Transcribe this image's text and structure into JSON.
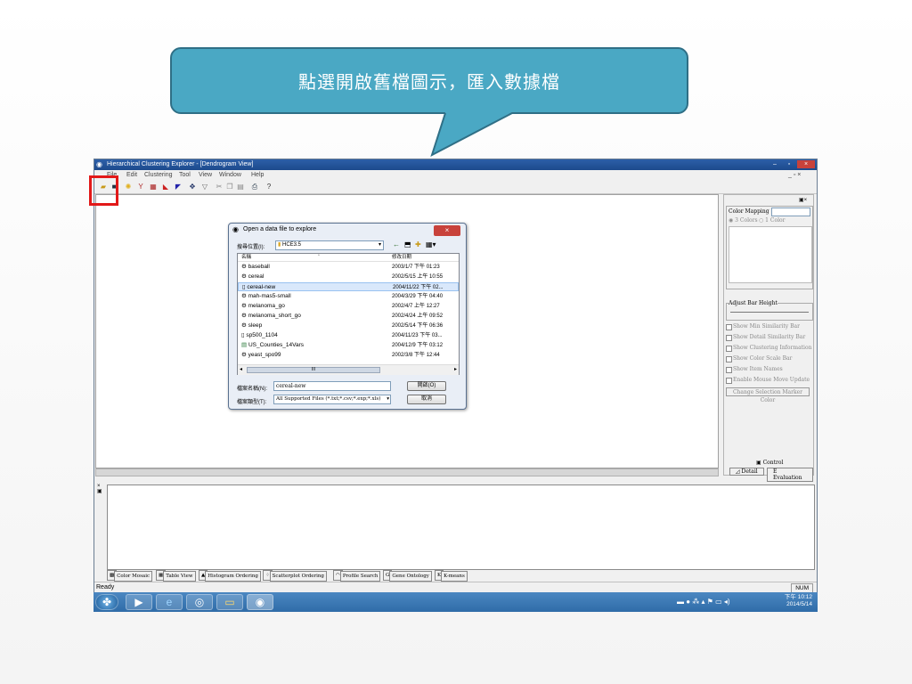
{
  "callout": {
    "text": "點選開啟舊檔圖示，匯入數據檔"
  },
  "window": {
    "title": "Hierarchical Clustering Explorer - [Dendrogram View]",
    "menu": [
      "File",
      "Edit",
      "Clustering",
      "Tool",
      "View",
      "Window",
      "Help"
    ]
  },
  "dialog": {
    "title": "Open a data file to explore",
    "look_in_label": "搜尋位置(I):",
    "look_in_value": "HCE3.5",
    "col_name": "名稱",
    "col_date": "修改日期",
    "files": [
      {
        "name": "baseball",
        "date": "2003/1/7 下午 01:23"
      },
      {
        "name": "cereal",
        "date": "2002/5/15 上午 10:55"
      },
      {
        "name": "cereal-new",
        "date": "2004/11/22 下午 02..."
      },
      {
        "name": "mah-mas5-small",
        "date": "2004/3/29 下午 04:40"
      },
      {
        "name": "melanoma_go",
        "date": "2002/4/7 上午 12:27"
      },
      {
        "name": "melanoma_short_go",
        "date": "2002/4/24 上午 09:52"
      },
      {
        "name": "sleep",
        "date": "2002/5/14 下午 06:36"
      },
      {
        "name": "sp500_1104",
        "date": "2004/11/23 下午 03..."
      },
      {
        "name": "US_Counties_14Vars",
        "date": "2004/12/9 下午 03:12"
      },
      {
        "name": "yeast_spo99",
        "date": "2002/3/8 下午 12:44"
      }
    ],
    "filename_label": "檔案名稱(N):",
    "filename_value": "cereal-new",
    "filetype_label": "檔案類型(T):",
    "filetype_value": "All Supported Files (*.txt;*.csv;*.exp;*.xls)",
    "open_button": "開啟(O)",
    "cancel_button": "取消",
    "scroll_mid": "III"
  },
  "control_panel": {
    "color_mapping": "Color Mapping",
    "three_colors": "3 Colors",
    "one_color": "1 Color",
    "adjust_bar": "Adjust Bar Height",
    "options": [
      "Show Min Similarity Bar",
      "Show Detail Similarity Bar",
      "Show Clustering Information",
      "Show Color Scale Bar",
      "Show Item Names",
      "Enable Mouse Move Update"
    ],
    "change_color_button": "Change Selection Marker Color",
    "control_tab": "Control",
    "detail_tab": "Detail",
    "evaluation_tab": "Evaluation"
  },
  "bottom_tabs": [
    "Color Mosaic",
    "Table View",
    "Histogram Ordering",
    "Scatterplot Ordering",
    "Profile Search",
    "Gene Ontology",
    "K-means"
  ],
  "status": {
    "ready": "Ready",
    "num": "NUM"
  },
  "taskbar": {
    "time": "下午 10:12",
    "date": "2014/5/14"
  },
  "colors": {
    "callout": "#4aa8c4",
    "highlight": "#e21818",
    "titlebar": "#2c5fa8"
  }
}
